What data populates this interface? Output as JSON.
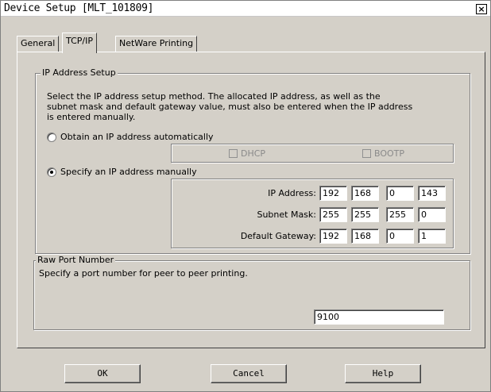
{
  "window": {
    "title": "Device Setup [MLT_101809]",
    "close_label": "×"
  },
  "tabs": [
    {
      "label": "General"
    },
    {
      "label": "TCP/IP"
    },
    {
      "label": "NetWare Printing"
    }
  ],
  "ip_setup": {
    "group_label": "IP Address Setup",
    "description": [
      "Select the IP address setup method. The allocated IP address, as well as the",
      "subnet mask and default gateway value, must also be entered when the IP address",
      "is entered manually."
    ],
    "auto_label": "Obtain an IP address automatically",
    "auto_selected": false,
    "dhcp_label": "DHCP",
    "dhcp_checked": false,
    "bootp_label": "BOOTP",
    "bootp_checked": false,
    "manual_label": "Specify an IP address manually",
    "manual_selected": true,
    "ip_label": "IP Address:",
    "ip": [
      "192",
      "168",
      "0",
      "143"
    ],
    "subnet_label": "Subnet Mask:",
    "subnet": [
      "255",
      "255",
      "255",
      "0"
    ],
    "gateway_label": "Default Gateway:",
    "gateway": [
      "192",
      "168",
      "0",
      "1"
    ]
  },
  "raw_port": {
    "group_label": "Raw Port Number",
    "description": "Specify a port number for peer to peer printing.",
    "value": "9100"
  },
  "buttons": {
    "ok": "OK",
    "cancel": "Cancel",
    "help": "Help"
  }
}
